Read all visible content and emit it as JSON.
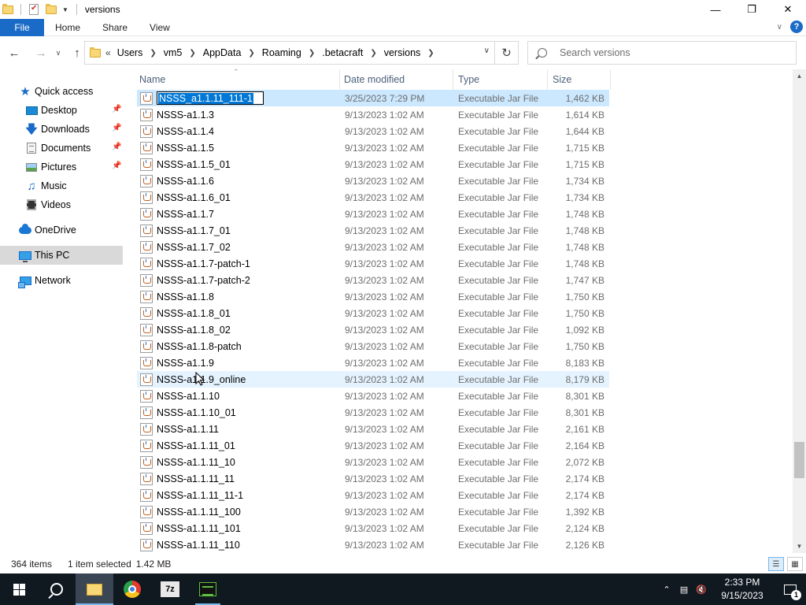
{
  "window": {
    "title": "versions",
    "minimize_glyph": "—",
    "maximize_glyph": "❐",
    "close_glyph": "✕"
  },
  "ribbon": {
    "file": "File",
    "tabs": [
      "Home",
      "Share",
      "View"
    ]
  },
  "address": {
    "lead": "«",
    "crumbs": [
      "Users",
      "vm5",
      "AppData",
      "Roaming",
      ".betacraft",
      "versions"
    ],
    "search_placeholder": "Search versions"
  },
  "navpane": {
    "items": [
      {
        "label": "Quick access",
        "icon": "star-icon",
        "pinned": false
      },
      {
        "label": "Desktop",
        "icon": "desktop-icon",
        "pinned": true
      },
      {
        "label": "Downloads",
        "icon": "download-icon",
        "pinned": true
      },
      {
        "label": "Documents",
        "icon": "documents-icon",
        "pinned": true
      },
      {
        "label": "Pictures",
        "icon": "pictures-icon",
        "pinned": true
      },
      {
        "label": "Music",
        "icon": "music-icon",
        "pinned": false
      },
      {
        "label": "Videos",
        "icon": "videos-icon",
        "pinned": false
      },
      {
        "label": "OneDrive",
        "icon": "onedrive-icon",
        "pinned": false
      },
      {
        "label": "This PC",
        "icon": "this-pc-icon",
        "pinned": false,
        "selected": true
      },
      {
        "label": "Network",
        "icon": "network-icon",
        "pinned": false
      }
    ]
  },
  "columns": {
    "name": "Name",
    "date": "Date modified",
    "type": "Type",
    "size": "Size"
  },
  "files": [
    {
      "name": "NSSS_a1.1.11_111-1",
      "date": "3/25/2023 7:29 PM",
      "type": "Executable Jar File",
      "size": "1,462 KB",
      "state": "renaming"
    },
    {
      "name": "NSSS-a1.1.3",
      "date": "9/13/2023 1:02 AM",
      "type": "Executable Jar File",
      "size": "1,614 KB"
    },
    {
      "name": "NSSS-a1.1.4",
      "date": "9/13/2023 1:02 AM",
      "type": "Executable Jar File",
      "size": "1,644 KB"
    },
    {
      "name": "NSSS-a1.1.5",
      "date": "9/13/2023 1:02 AM",
      "type": "Executable Jar File",
      "size": "1,715 KB"
    },
    {
      "name": "NSSS-a1.1.5_01",
      "date": "9/13/2023 1:02 AM",
      "type": "Executable Jar File",
      "size": "1,715 KB"
    },
    {
      "name": "NSSS-a1.1.6",
      "date": "9/13/2023 1:02 AM",
      "type": "Executable Jar File",
      "size": "1,734 KB"
    },
    {
      "name": "NSSS-a1.1.6_01",
      "date": "9/13/2023 1:02 AM",
      "type": "Executable Jar File",
      "size": "1,734 KB"
    },
    {
      "name": "NSSS-a1.1.7",
      "date": "9/13/2023 1:02 AM",
      "type": "Executable Jar File",
      "size": "1,748 KB"
    },
    {
      "name": "NSSS-a1.1.7_01",
      "date": "9/13/2023 1:02 AM",
      "type": "Executable Jar File",
      "size": "1,748 KB"
    },
    {
      "name": "NSSS-a1.1.7_02",
      "date": "9/13/2023 1:02 AM",
      "type": "Executable Jar File",
      "size": "1,748 KB"
    },
    {
      "name": "NSSS-a1.1.7-patch-1",
      "date": "9/13/2023 1:02 AM",
      "type": "Executable Jar File",
      "size": "1,748 KB"
    },
    {
      "name": "NSSS-a1.1.7-patch-2",
      "date": "9/13/2023 1:02 AM",
      "type": "Executable Jar File",
      "size": "1,747 KB"
    },
    {
      "name": "NSSS-a1.1.8",
      "date": "9/13/2023 1:02 AM",
      "type": "Executable Jar File",
      "size": "1,750 KB"
    },
    {
      "name": "NSSS-a1.1.8_01",
      "date": "9/13/2023 1:02 AM",
      "type": "Executable Jar File",
      "size": "1,750 KB"
    },
    {
      "name": "NSSS-a1.1.8_02",
      "date": "9/13/2023 1:02 AM",
      "type": "Executable Jar File",
      "size": "1,092 KB"
    },
    {
      "name": "NSSS-a1.1.8-patch",
      "date": "9/13/2023 1:02 AM",
      "type": "Executable Jar File",
      "size": "1,750 KB"
    },
    {
      "name": "NSSS-a1.1.9",
      "date": "9/13/2023 1:02 AM",
      "type": "Executable Jar File",
      "size": "8,183 KB"
    },
    {
      "name": "NSSS-a1.1.9_online",
      "date": "9/13/2023 1:02 AM",
      "type": "Executable Jar File",
      "size": "8,179 KB",
      "state": "hover"
    },
    {
      "name": "NSSS-a1.1.10",
      "date": "9/13/2023 1:02 AM",
      "type": "Executable Jar File",
      "size": "8,301 KB"
    },
    {
      "name": "NSSS-a1.1.10_01",
      "date": "9/13/2023 1:02 AM",
      "type": "Executable Jar File",
      "size": "8,301 KB"
    },
    {
      "name": "NSSS-a1.1.11",
      "date": "9/13/2023 1:02 AM",
      "type": "Executable Jar File",
      "size": "2,161 KB"
    },
    {
      "name": "NSSS-a1.1.11_01",
      "date": "9/13/2023 1:02 AM",
      "type": "Executable Jar File",
      "size": "2,164 KB"
    },
    {
      "name": "NSSS-a1.1.11_10",
      "date": "9/13/2023 1:02 AM",
      "type": "Executable Jar File",
      "size": "2,072 KB"
    },
    {
      "name": "NSSS-a1.1.11_11",
      "date": "9/13/2023 1:02 AM",
      "type": "Executable Jar File",
      "size": "2,174 KB"
    },
    {
      "name": "NSSS-a1.1.11_11-1",
      "date": "9/13/2023 1:02 AM",
      "type": "Executable Jar File",
      "size": "2,174 KB"
    },
    {
      "name": "NSSS-a1.1.11_100",
      "date": "9/13/2023 1:02 AM",
      "type": "Executable Jar File",
      "size": "1,392 KB"
    },
    {
      "name": "NSSS-a1.1.11_101",
      "date": "9/13/2023 1:02 AM",
      "type": "Executable Jar File",
      "size": "2,124 KB"
    },
    {
      "name": "NSSS-a1.1.11_110",
      "date": "9/13/2023 1:02 AM",
      "type": "Executable Jar File",
      "size": "2,126 KB"
    }
  ],
  "status": {
    "item_count": "364 items",
    "selection": "1 item selected",
    "selection_size": "1.42 MB"
  },
  "taskbar": {
    "apps": [
      "windows-start",
      "search",
      "file-explorer",
      "chrome",
      "7-zip",
      "terminal"
    ],
    "zip_label": "7z",
    "time": "2:33 PM",
    "date": "9/15/2023",
    "notification_count": "1"
  },
  "colors": {
    "accent": "#1a6bc7",
    "selection": "#cce8ff",
    "hover": "#e5f3ff",
    "taskbar": "#101820"
  }
}
